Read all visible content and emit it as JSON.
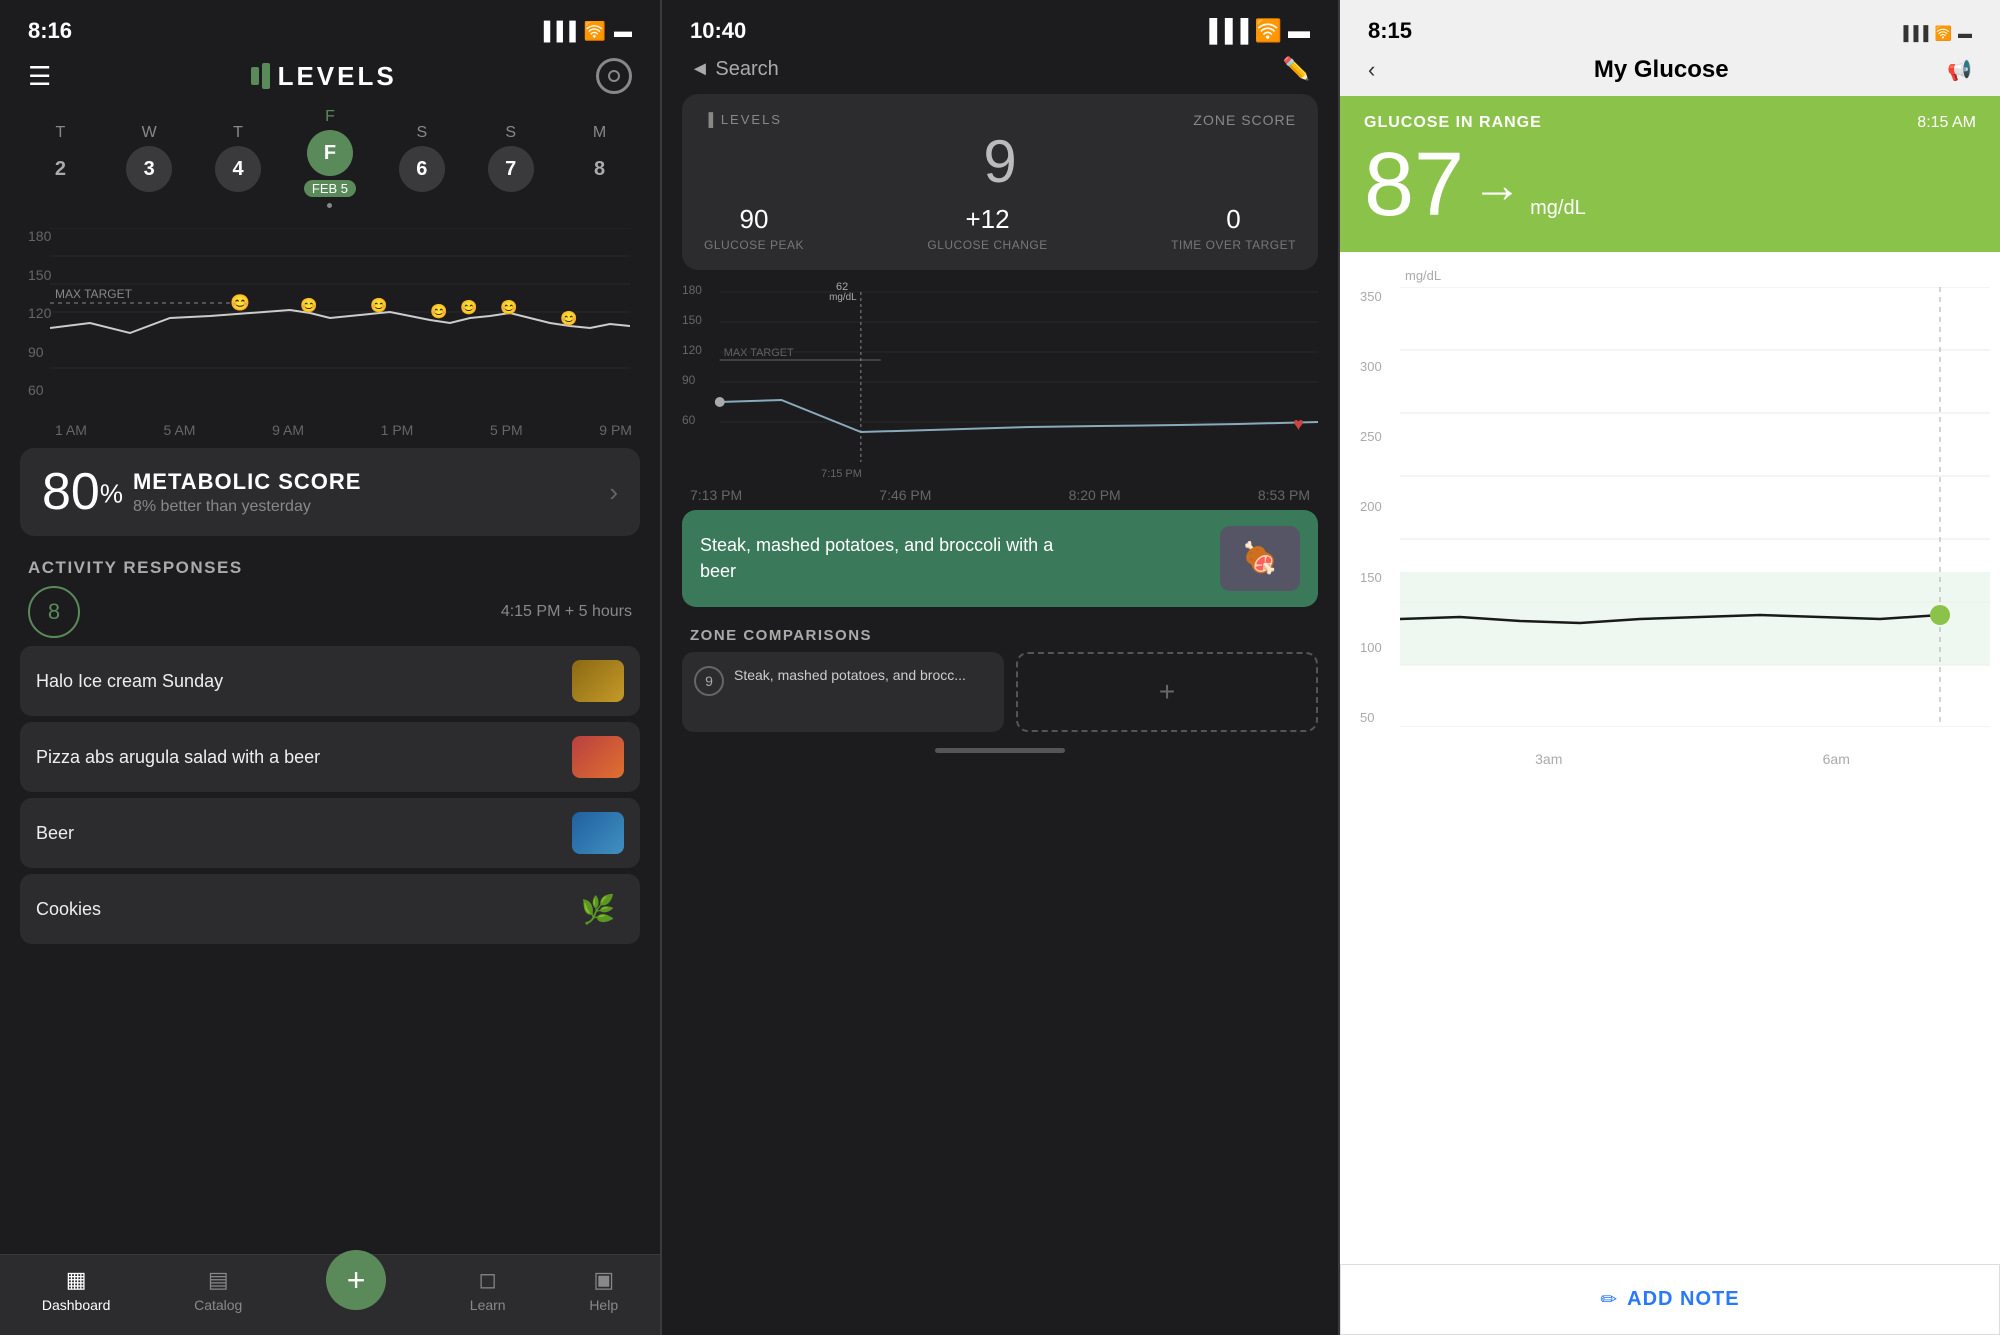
{
  "screen1": {
    "status_time": "8:16",
    "logo": "LEVELS",
    "days": [
      {
        "label": "T",
        "num": "2",
        "active": false
      },
      {
        "label": "W",
        "num": "3",
        "active": false,
        "selected": true
      },
      {
        "label": "T",
        "num": "4",
        "active": false,
        "selected": true
      },
      {
        "label": "F",
        "num": "FEB 5",
        "active": true
      },
      {
        "label": "S",
        "num": "6",
        "active": false,
        "selected": true
      },
      {
        "label": "S",
        "num": "7",
        "active": false,
        "selected": true
      },
      {
        "label": "M",
        "num": "8",
        "active": false
      }
    ],
    "chart_y": [
      "180",
      "150",
      "120",
      "90",
      "60"
    ],
    "chart_x": [
      "1 AM",
      "5 AM",
      "9 AM",
      "1 PM",
      "5 PM",
      "9 PM"
    ],
    "max_target_label": "MAX TARGET",
    "metabolic_score": "80",
    "metabolic_pct": "%",
    "metabolic_title": "METABOLIC SCORE",
    "metabolic_subtitle": "8% better than yesterday",
    "activity_label": "ACTIVITY RESPONSES",
    "activity_time": "4:15 PM + 5 hours",
    "activity_score": "8",
    "foods": [
      {
        "name": "Halo Ice cream Sunday",
        "has_img": true,
        "img_class": "food-img-1"
      },
      {
        "name": "Pizza abs arugula salad with a beer",
        "has_img": true,
        "img_class": "food-img-2"
      },
      {
        "name": "Beer",
        "has_img": true,
        "img_class": "food-img-3"
      },
      {
        "name": "Cookies",
        "has_img": false,
        "icon": "🌿"
      }
    ],
    "nav": [
      {
        "label": "Dashboard",
        "icon": "▦",
        "active": true
      },
      {
        "label": "Catalog",
        "icon": "▤",
        "active": false
      },
      {
        "label": "",
        "icon": "+",
        "is_add": true
      },
      {
        "label": "Learn",
        "icon": "◻",
        "active": false
      },
      {
        "label": "Help",
        "icon": "▣",
        "active": false
      }
    ]
  },
  "screen2": {
    "status_time": "10:40",
    "search_label": "Search",
    "zone_score": "9",
    "zone_score_label": "ZONE SCORE",
    "glucose_peak": "90",
    "glucose_peak_label": "GLUCOSE PEAK",
    "glucose_change": "+12",
    "glucose_change_label": "GLUCOSE CHANGE",
    "time_over_target": "0",
    "time_over_target_label": "TIME OVER TARGET",
    "chart_annotation": "62",
    "chart_annotation_sub": "mg/dL",
    "chart_annotation_time": "7:15 PM",
    "chart_y": [
      "180",
      "150",
      "120",
      "90",
      "60"
    ],
    "max_target": "MAX TARGET",
    "chart_x": [
      "7:13 PM",
      "7:46 PM",
      "8:20 PM",
      "8:53 PM"
    ],
    "meal_name": "Steak, mashed potatoes, and broccoli with a beer",
    "zone_comparisons_label": "ZONE COMPARISONS",
    "comp_score": "9",
    "comp_meal": "Steak, mashed potatoes, and brocc..."
  },
  "screen3": {
    "status_time": "8:15",
    "page_title": "My Glucose",
    "glucose_status": "GLUCOSE IN RANGE",
    "timestamp": "8:15 AM",
    "glucose_value": "87",
    "glucose_unit": "mg/dL",
    "y_label_top": "mg/dL",
    "y_labels": [
      "350",
      "300",
      "250",
      "200",
      "150",
      "100",
      "50"
    ],
    "x_labels": [
      "3am",
      "6am"
    ],
    "add_note_label": "ADD NOTE"
  }
}
